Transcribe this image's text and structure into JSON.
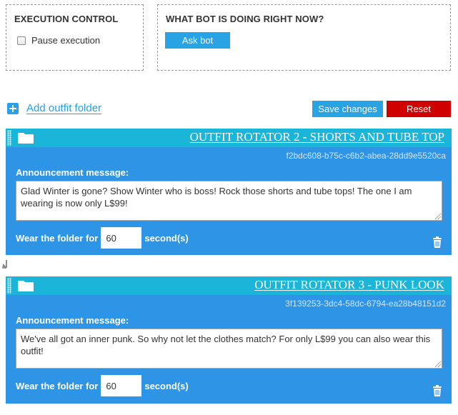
{
  "execution_control": {
    "title": "EXECUTION CONTROL",
    "pause_label": "Pause execution",
    "pause_checked": false
  },
  "bot_status": {
    "title": "WHAT BOT IS DOING RIGHT NOW?",
    "ask_label": "Ask bot"
  },
  "toolbar": {
    "add_folder_label": "Add outfit folder",
    "save_label": "Save changes",
    "reset_label": "Reset"
  },
  "folders": [
    {
      "title": "OUTFIT ROTATOR 2 - SHORTS AND TUBE TOP",
      "id": "f2bdc608-b75c-c6b2-abea-28dd9e5520ca",
      "announcement_label": "Announcement message:",
      "message": "Glad Winter is gone? Show Winter who is boss! Rock those shorts and tube tops! The one I am wearing is now only L$99!",
      "wear_label": "Wear the folder for",
      "seconds": "60",
      "unit_label": "second(s)"
    },
    {
      "title": "OUTFIT ROTATOR 3 - PUNK LOOK",
      "id": "3f139253-3dc4-58dc-6794-ea28b48151d2",
      "announcement_label": "Announcement message:",
      "message": "We've all got an inner punk. So why not let the clothes match? For only L$99 you can also wear this outfit!",
      "wear_label": "Wear the folder for",
      "seconds": "60",
      "unit_label": "second(s)"
    }
  ],
  "colors": {
    "accent": "#29a3e3",
    "danger": "#d00000",
    "card": "#2e95e6",
    "card_header": "#1ab5d8"
  },
  "icons": [
    "plus-icon",
    "folder-icon",
    "trash-icon",
    "arrow-down-icon",
    "drag-handle-icon"
  ]
}
